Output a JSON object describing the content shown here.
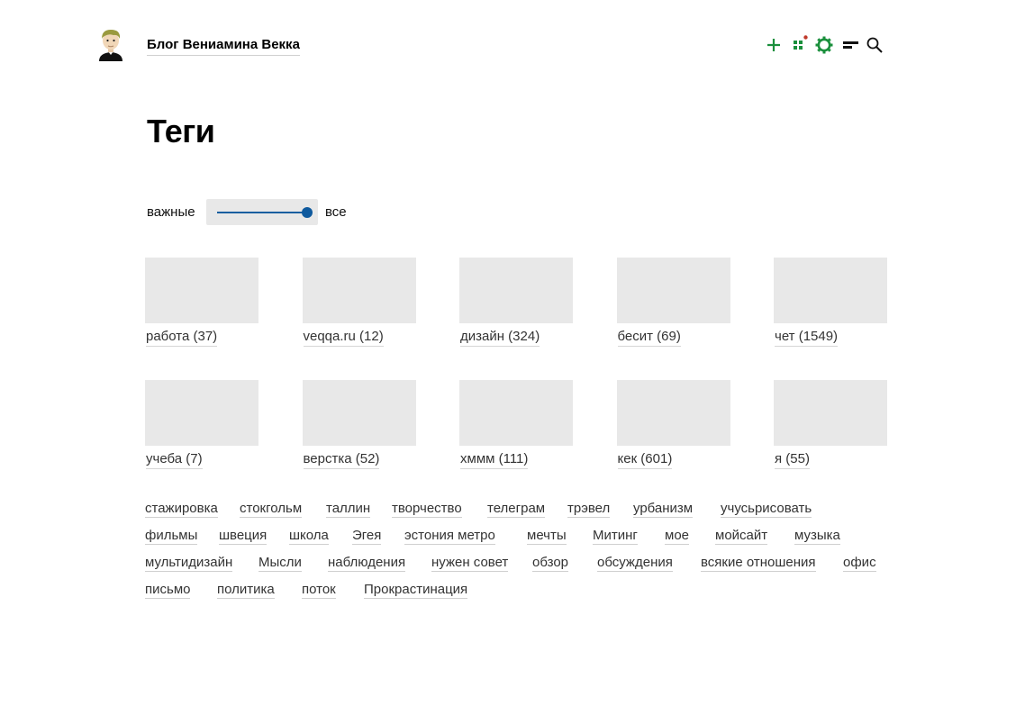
{
  "header": {
    "site_title": "Блог Вениамина Векка",
    "avatar_icon": "user-avatar-icon",
    "toolbar": [
      {
        "icon": "plus-icon",
        "color": "#1a8f3c"
      },
      {
        "icon": "grid-icon",
        "color": "#1a8f3c",
        "badge_color": "#c0392b"
      },
      {
        "icon": "gear-icon",
        "color": "#1a8f3c"
      },
      {
        "icon": "menu-icon",
        "color": "#111111"
      },
      {
        "icon": "search-icon",
        "color": "#111111"
      }
    ]
  },
  "main": {
    "title": "Теги",
    "filter": {
      "left_label": "важные",
      "right_label": "все",
      "value": 1.0,
      "accent": "#0f5a9e"
    },
    "featured_tags": [
      {
        "label": "работа (37)"
      },
      {
        "label": "veqqa.ru (12)"
      },
      {
        "label": "дизайн (324)"
      },
      {
        "label": "бесит (69)"
      },
      {
        "label": "чет (1549)"
      },
      {
        "label": "учеба (7)"
      },
      {
        "label": "верстка (52)"
      },
      {
        "label": "хммм (111)"
      },
      {
        "label": "кек (601)"
      },
      {
        "label": "я (55)"
      }
    ],
    "tag_cloud": [
      [
        "стажировка",
        "стокгольм",
        "таллин",
        "творчество",
        "телеграм",
        "трэвел",
        "урбанизм",
        "учусьрисовать"
      ],
      [
        "фильмы",
        "швеция",
        "школа",
        "Эгея",
        "эстония  метро",
        "мечты",
        "Митинг",
        "мое",
        "мойсайт",
        "музыка"
      ],
      [
        "мультидизайн",
        "Мысли",
        "наблюдения",
        "нужен совет",
        "обзор",
        "обсуждения",
        "всякие отношения",
        "офис"
      ],
      [
        "письмо",
        "политика",
        "поток",
        "Прокрастинация"
      ]
    ]
  }
}
